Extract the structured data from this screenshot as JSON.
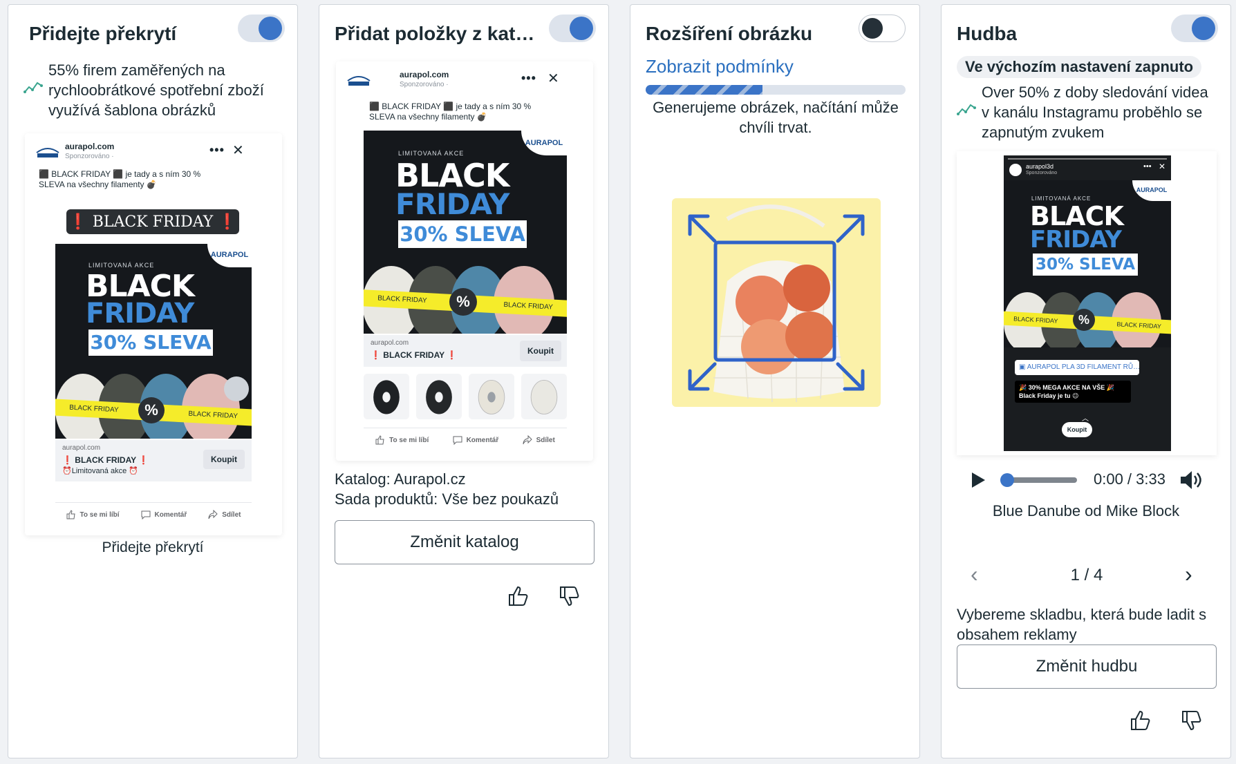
{
  "cards": [
    {
      "title": "Přidejte překrytí",
      "toggle_on": true,
      "stat": "55% firem zaměřených na rychloobrátkové spotřební zboží využívá šablona obrázků",
      "stat_icon": "trend-line-icon",
      "preview": {
        "site": "aurapol.com",
        "sponsored": "Sponzorováno ·",
        "copy": "⬛ BLACK FRIDAY ⬛ je tady a s ním 30 % SLEVA na všechny filamenty 💣",
        "overlay_banner": "❗ BLACK FRIDAY ❗",
        "poster": {
          "label": "LIMITOVANÁ AKCE",
          "line1": "BLACK",
          "line2": "FRIDAY",
          "discount": "30% SLEVA",
          "brand": "AURAPOL",
          "band": "BLACK FRIDAY",
          "pct": "%"
        },
        "cta_site": "aurapol.com",
        "cta_title": "❗ BLACK FRIDAY ❗",
        "cta_sub": "⏰Limitovaná akce ⏰",
        "cta_button": "Koupit",
        "actions": [
          "To se mi líbí",
          "Komentář",
          "Sdílet"
        ]
      },
      "caption": "Přidejte překrytí"
    },
    {
      "title": "Přidat položky z katal…",
      "toggle_on": true,
      "preview": {
        "site": "aurapol.com",
        "sponsored": "Sponzorováno ·",
        "copy": "⬛ BLACK FRIDAY ⬛ je tady a s ním 30 % SLEVA na všechny filamenty 💣",
        "poster": {
          "label": "LIMITOVANÁ AKCE",
          "line1": "BLACK",
          "line2": "FRIDAY",
          "discount": "30% SLEVA",
          "brand": "AURAPOL",
          "band": "BLACK FRIDAY",
          "pct": "%"
        },
        "cta_site": "aurapol.com",
        "cta_title": "❗ BLACK FRIDAY ❗",
        "cta_button": "Koupit",
        "actions": [
          "To se mi líbí",
          "Komentář",
          "Sdílet"
        ]
      },
      "catalog_line": "Katalog: Aurapol.cz",
      "product_set_line": "Sada produktů: Vše bez poukazů",
      "button": "Změnit katalog"
    },
    {
      "title": "Rozšíření obrázku",
      "toggle_on": false,
      "link": "Zobrazit podmínky",
      "progress_text": "Generujeme obrázek, načítání může chvíli trvat.",
      "progress": 0.45
    },
    {
      "title": "Hudba",
      "toggle_on": true,
      "badge": "Ve výchozím nastavení zapnuto",
      "stat": "Over 50% z doby sledování videa v kanálu Instagramu proběhlo se zapnutým zvukem",
      "stat_icon": "trend-line-icon",
      "story": {
        "account": "aurapol3d",
        "sponsored": "Sponzorováno",
        "poster": {
          "label": "LIMITOVANÁ AKCE",
          "line1": "BLACK",
          "line2": "FRIDAY",
          "discount": "30% SLEVA",
          "brand": "AURAPOL",
          "band": "BLACK FRIDAY",
          "pct": "%"
        },
        "product_tag": "AURAPOL PLA 3D FILAMENT RŮ…",
        "caption": "🎉 30% MEGA AKCE NA VŠE 🎉 Black Friday je tu 😉",
        "cta": "Koupit"
      },
      "player": {
        "time": "0:00 / 3:33",
        "position": 0.0
      },
      "song": "Blue Danube od Mike Block",
      "pager": "1 / 4",
      "description": "Vybereme skladbu, která bude ladit s obsahem reklamy",
      "button": "Změnit hudbu"
    }
  ],
  "colors": {
    "accent": "#3b74c7",
    "link": "#2a6fbf",
    "text": "#1c2b33",
    "poster_blue": "#3f8bd8",
    "band_yellow": "#f5ec2a"
  }
}
